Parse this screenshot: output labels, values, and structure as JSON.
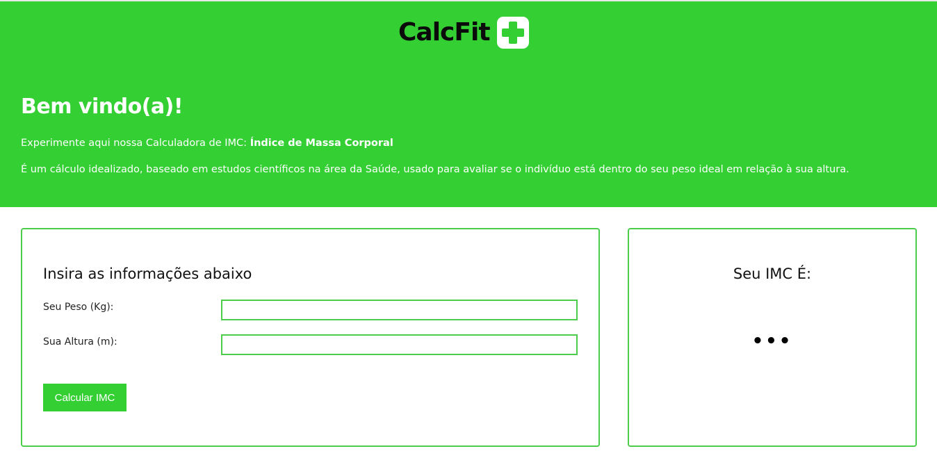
{
  "header": {
    "logo_text": "CalcFit",
    "welcome_title": "Bem vindo(a)!",
    "intro_prefix": "Experimente aqui nossa Calculadora de IMC: ",
    "intro_highlight": "Índice de Massa Corporal",
    "description": "É um cálculo idealizado, baseado em estudos científicos na área da Saúde, usado para avaliar se o indivíduo está dentro do seu peso ideal em relação à sua altura."
  },
  "form": {
    "title": "Insira as informações abaixo",
    "weight_label": "Seu Peso (Kg):",
    "weight_value": "",
    "height_label": "Sua Altura (m):",
    "height_value": "",
    "submit_label": "Calcular IMC"
  },
  "result": {
    "title": "Seu IMC É:",
    "value": "•••"
  },
  "colors": {
    "brand_green": "#33cf33",
    "border_green": "#4bcc4b"
  }
}
